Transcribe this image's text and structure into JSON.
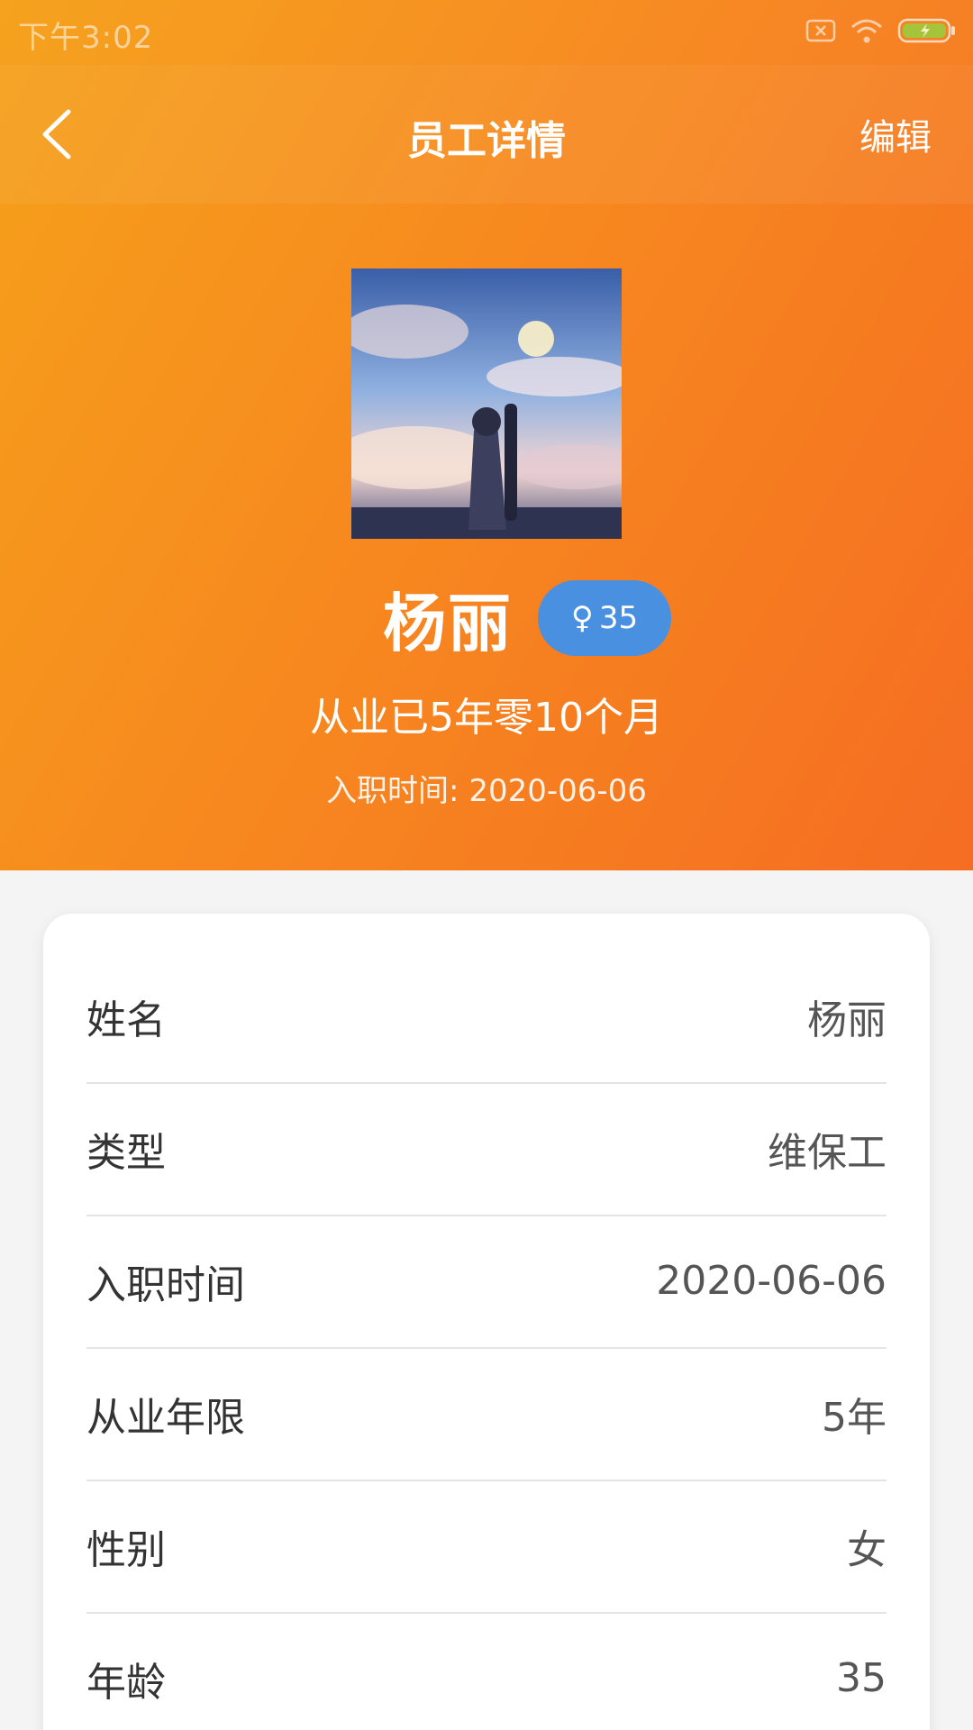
{
  "status_bar": {
    "time": "下午3:02",
    "icons": [
      "sim-off-icon",
      "wifi-icon",
      "battery-charging-icon"
    ]
  },
  "nav": {
    "title": "员工详情",
    "edit_label": "编辑",
    "back_icon": "chevron-left-icon"
  },
  "profile": {
    "name": "杨丽",
    "gender_symbol": "♀",
    "age": "35",
    "career_duration": "从业已5年零10个月",
    "join_date_text": "入职时间: 2020-06-06"
  },
  "details": [
    {
      "label": "姓名",
      "value": "杨丽"
    },
    {
      "label": "类型",
      "value": "维保工"
    },
    {
      "label": "入职时间",
      "value": "2020-06-06"
    },
    {
      "label": "从业年限",
      "value": "5年"
    },
    {
      "label": "性别",
      "value": "女"
    },
    {
      "label": "年龄",
      "value": "35"
    }
  ],
  "colors": {
    "header_gradient_start": "#f5a11a",
    "header_gradient_end": "#f56d22",
    "badge_blue": "#4a90e0",
    "background": "#f4f4f4"
  }
}
